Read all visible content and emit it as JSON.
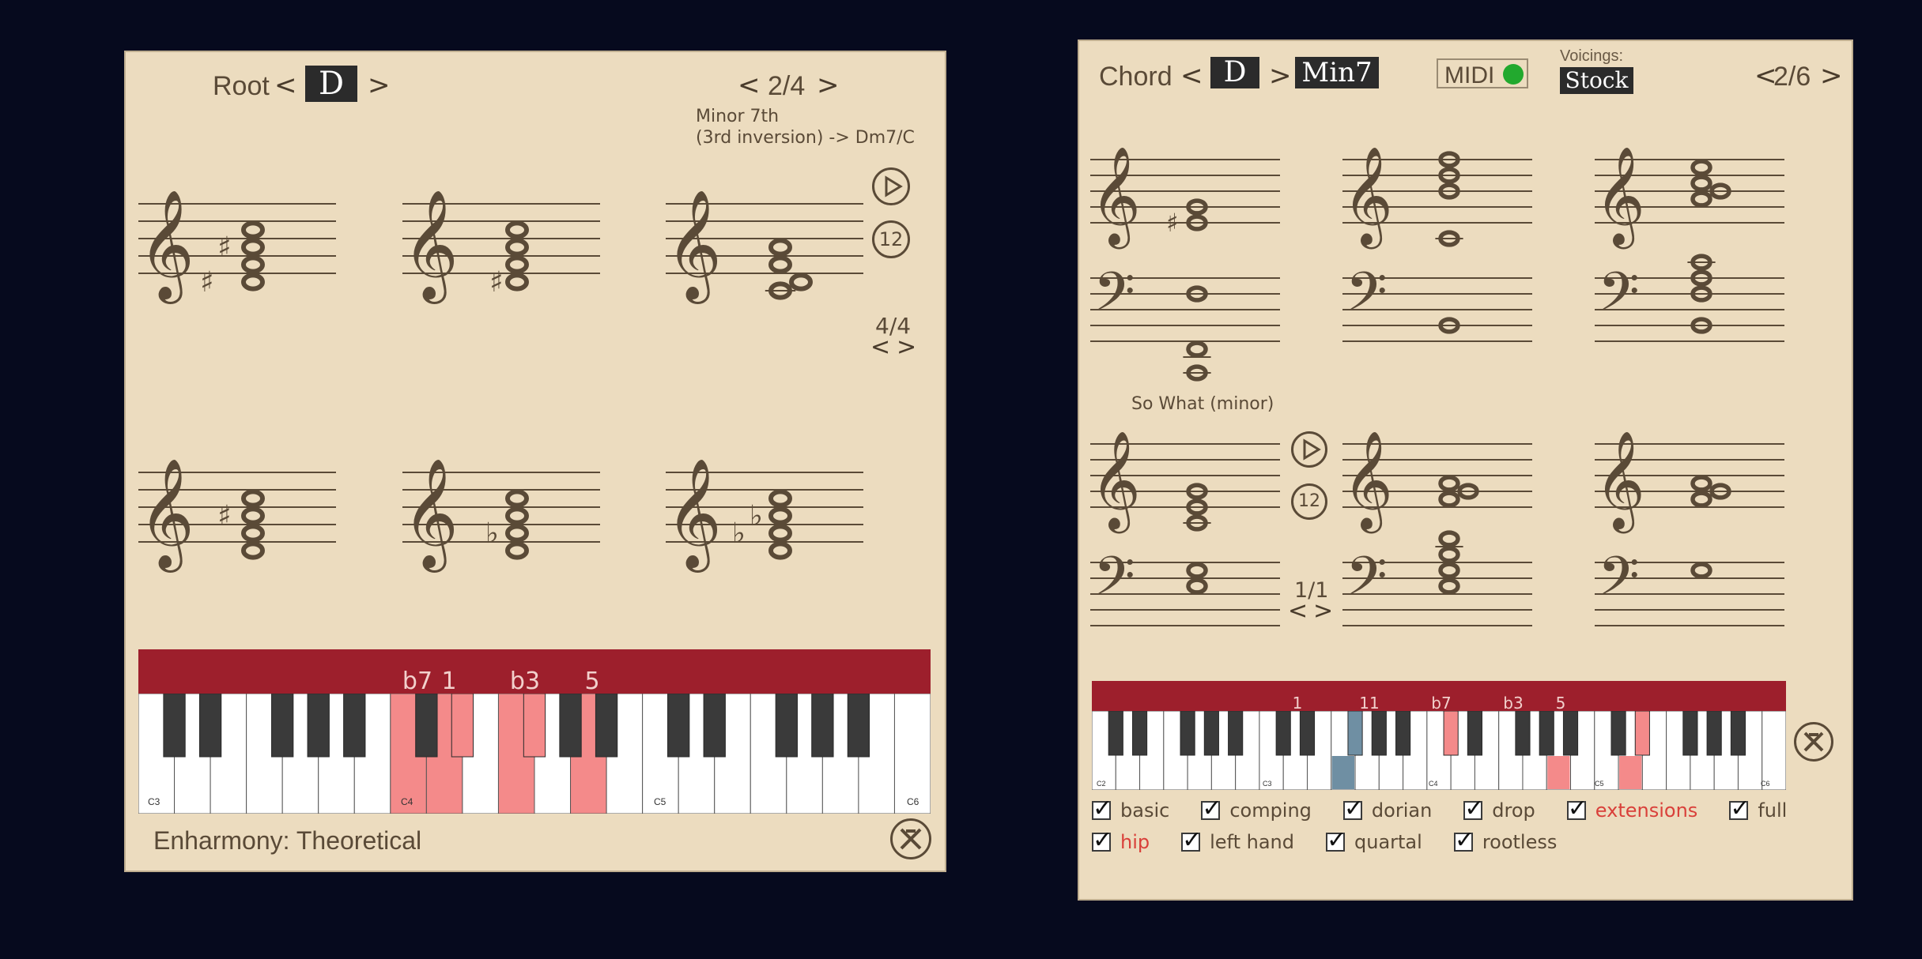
{
  "left": {
    "root_label": "Root",
    "root_value": "D",
    "page_indicator": "2/4",
    "chord_name": "Minor 7th",
    "inversion_text": "(3rd inversion) -> Dm7/C",
    "measure_counter": "4/4",
    "enharmony_label": "Enharmony: Theoretical",
    "piano_octave_labels": [
      "C3",
      "C4",
      "C5",
      "C6"
    ],
    "piano_interval_labels": [
      "b7",
      "1",
      "b3",
      "5"
    ],
    "highlight_color": "#f48a8a"
  },
  "right": {
    "chord_label": "Chord",
    "root_value": "D",
    "quality_value": "Min7",
    "midi_label": "MIDI",
    "midi_status_color": "#22a92e",
    "voicings_label": "Voicings:",
    "voicings_value": "Stock",
    "page_indicator": "2/6",
    "voicing_name": "So What (minor)",
    "measure_counter": "1/1",
    "piano_octave_labels": [
      "C2",
      "C3",
      "C4",
      "C5",
      "C6"
    ],
    "piano_interval_labels": [
      "1",
      "11",
      "b7",
      "b3",
      "5"
    ],
    "blue_key_color": "#6f8fa3",
    "checkboxes_row1": [
      {
        "label": "basic",
        "checked": true,
        "highlight": false
      },
      {
        "label": "comping",
        "checked": true,
        "highlight": false
      },
      {
        "label": "dorian",
        "checked": true,
        "highlight": false
      },
      {
        "label": "drop",
        "checked": true,
        "highlight": false
      },
      {
        "label": "extensions",
        "checked": true,
        "highlight": true
      },
      {
        "label": "full",
        "checked": true,
        "highlight": false
      }
    ],
    "checkboxes_row2": [
      {
        "label": "hip",
        "checked": true,
        "highlight": true
      },
      {
        "label": "left hand",
        "checked": true,
        "highlight": false
      },
      {
        "label": "quartal",
        "checked": true,
        "highlight": false
      },
      {
        "label": "rootless",
        "checked": true,
        "highlight": false
      }
    ]
  },
  "icons": [
    "play-icon",
    "twelve-icon",
    "close-icon"
  ]
}
